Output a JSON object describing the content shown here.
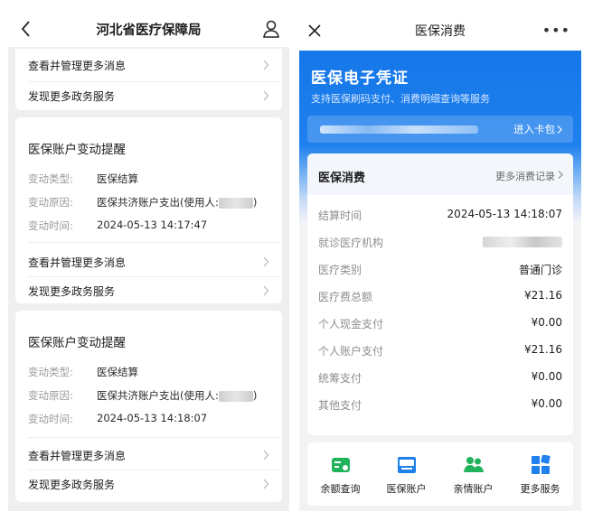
{
  "left": {
    "header": {
      "title": "河北省医疗保障局"
    },
    "top_links": [
      "查看并管理更多消息",
      "发现更多政务服务"
    ],
    "cards": [
      {
        "title": "医保账户变动提醒",
        "rows": [
          {
            "label": "变动类型:",
            "value": "医保结算"
          },
          {
            "label": "变动原因:",
            "value": "医保共济账户支出(使用人:",
            "value_end": ")"
          },
          {
            "label": "变动时间:",
            "value": "2024-05-13 14:17:47"
          }
        ],
        "links": [
          "查看并管理更多消息",
          "发现更多政务服务"
        ]
      },
      {
        "title": "医保账户变动提醒",
        "rows": [
          {
            "label": "变动类型:",
            "value": "医保结算"
          },
          {
            "label": "变动原因:",
            "value": "医保共济账户支出(使用人:",
            "value_end": ")"
          },
          {
            "label": "变动时间:",
            "value": "2024-05-13 14:18:07"
          }
        ],
        "links": [
          "查看并管理更多消息",
          "发现更多政务服务"
        ]
      }
    ]
  },
  "right": {
    "header": {
      "title": "医保消费",
      "more": "•••"
    },
    "brand": {
      "title": "医保电子凭证",
      "subtitle": "支持医保刷码支付、消费明细查询等服务"
    },
    "card_bar": {
      "enter_label": "进入卡包"
    },
    "consume": {
      "title": "医保消费",
      "more_link": "更多消费记录",
      "rows": [
        {
          "label": "结算时间",
          "value": "2024-05-13 14:18:07"
        },
        {
          "label": "就诊医疗机构",
          "value": ""
        },
        {
          "label": "医疗类别",
          "value": "普通门诊"
        },
        {
          "label": "医疗费总额",
          "value": "¥21.16"
        },
        {
          "label": "个人现金支付",
          "value": "¥0.00"
        },
        {
          "label": "个人账户支付",
          "value": "¥21.16"
        },
        {
          "label": "统筹支付",
          "value": "¥0.00"
        },
        {
          "label": "其他支付",
          "value": "¥0.00"
        }
      ]
    },
    "services": [
      {
        "label": "余额查询",
        "icon": "balance-icon"
      },
      {
        "label": "医保账户",
        "icon": "account-card-icon"
      },
      {
        "label": "亲情账户",
        "icon": "family-icon"
      },
      {
        "label": "更多服务",
        "icon": "grid-icon"
      }
    ],
    "colors": {
      "brand_blue": "#1677e8",
      "service_green": "#21b35a",
      "service_blue": "#1f80ee"
    }
  }
}
